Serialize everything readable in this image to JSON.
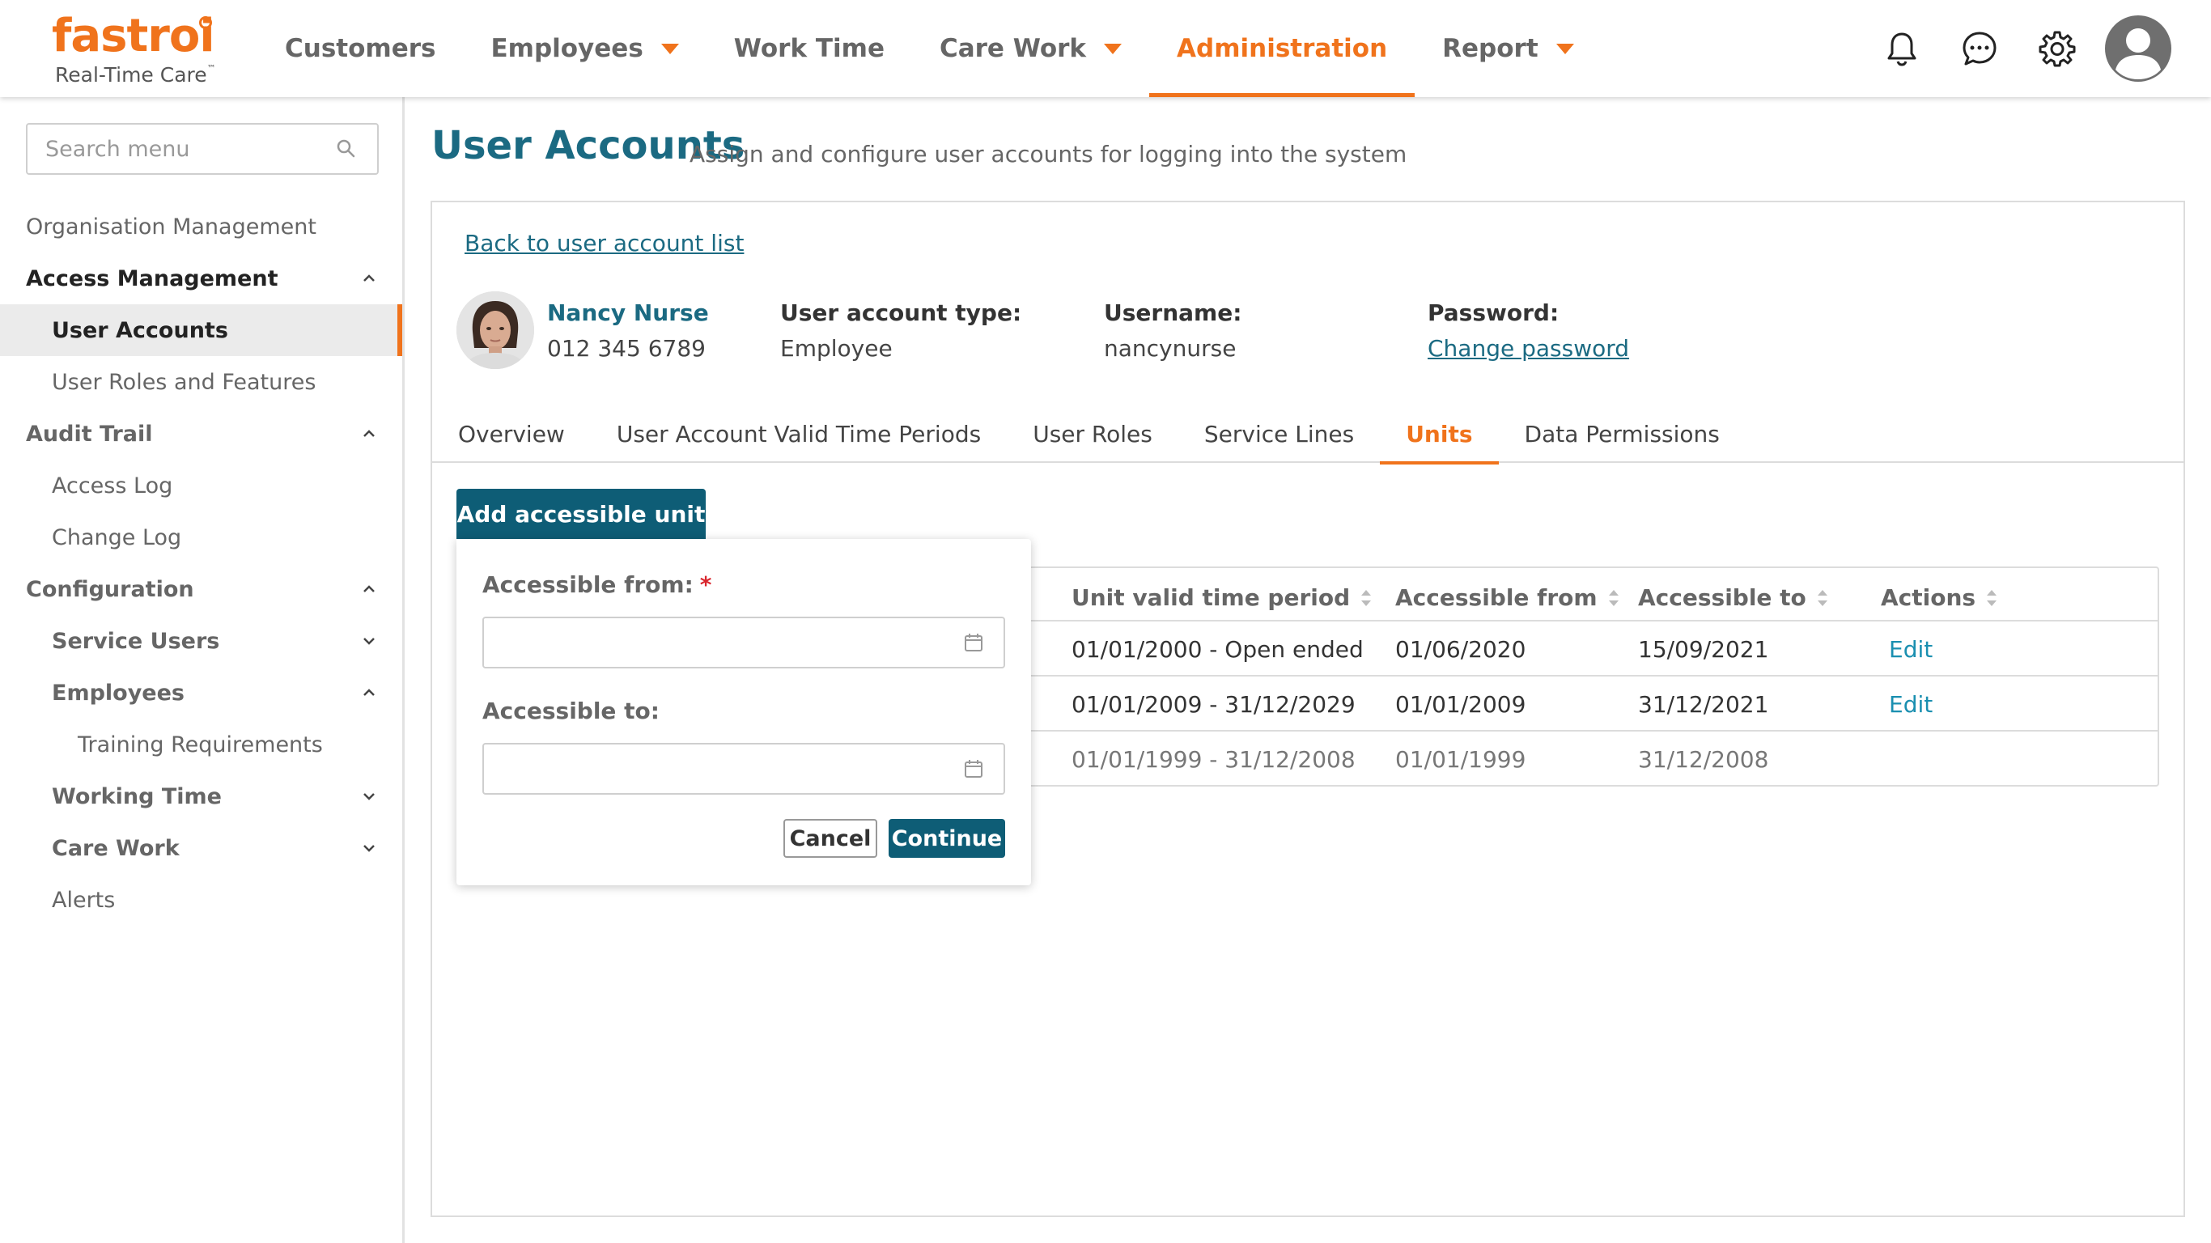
{
  "brand": {
    "name": "fastroi",
    "tagline": "Real-Time Care",
    "tm": "™",
    "accent_color": "#f0731c",
    "primary_color": "#0e5d76"
  },
  "topnav": {
    "items": [
      {
        "label": "Customers",
        "dropdown": false
      },
      {
        "label": "Employees",
        "dropdown": true
      },
      {
        "label": "Work Time",
        "dropdown": false
      },
      {
        "label": "Care Work",
        "dropdown": true
      },
      {
        "label": "Administration",
        "dropdown": false,
        "active": true
      },
      {
        "label": "Report",
        "dropdown": true
      }
    ],
    "icons": [
      "bell-icon",
      "chat-icon",
      "gear-icon",
      "user-avatar-icon"
    ]
  },
  "sidebar": {
    "search_placeholder": "Search menu",
    "items": [
      {
        "label": "Organisation Management"
      },
      {
        "label": "Access Management",
        "expanded": true
      },
      {
        "label": "User Accounts",
        "selected": true
      },
      {
        "label": "User Roles and Features"
      },
      {
        "label": "Audit Trail",
        "expanded": true
      },
      {
        "label": "Access Log"
      },
      {
        "label": "Change Log"
      },
      {
        "label": "Configuration",
        "expanded": true
      },
      {
        "label": "Service Users",
        "expanded": false
      },
      {
        "label": "Employees",
        "expanded": true
      },
      {
        "label": "Training Requirements"
      },
      {
        "label": "Working Time",
        "expanded": false
      },
      {
        "label": "Care Work",
        "expanded": false
      },
      {
        "label": "Alerts"
      }
    ]
  },
  "page": {
    "title": "User Accounts",
    "subtitle": "Assign and configure user accounts for logging into the system",
    "back_link": "Back to user account list"
  },
  "user": {
    "name": "Nancy Nurse",
    "phone": "012 345 6789",
    "account_type_label": "User account type:",
    "account_type": "Employee",
    "username_label": "Username:",
    "username": "nancynurse",
    "password_label": "Password:",
    "password_link": "Change password"
  },
  "tabs": [
    {
      "label": "Overview"
    },
    {
      "label": "User Account Valid Time Periods"
    },
    {
      "label": "User Roles"
    },
    {
      "label": "Service Lines"
    },
    {
      "label": "Units",
      "active": true
    },
    {
      "label": "Data Permissions"
    }
  ],
  "add_button": "Add accessible unit",
  "table": {
    "headers": [
      "Unit valid time period",
      "Accessible from",
      "Accessible to",
      "Actions"
    ],
    "rows": [
      {
        "period": "01/01/2000 - Open ended",
        "from": "01/06/2020",
        "to": "15/09/2021",
        "action": "Edit",
        "muted": false
      },
      {
        "period": "01/01/2009 - 31/12/2029",
        "from": "01/01/2009",
        "to": "31/12/2021",
        "action": "Edit",
        "muted": false
      },
      {
        "period": "01/01/1999 - 31/12/2008",
        "from": "01/01/1999",
        "to": "31/12/2008",
        "action": "",
        "muted": true
      }
    ]
  },
  "form": {
    "from_label": "Accessible from:",
    "required_mark": "*",
    "from_value": "",
    "to_label": "Accessible to:",
    "to_value": "",
    "cancel": "Cancel",
    "continue": "Continue"
  }
}
